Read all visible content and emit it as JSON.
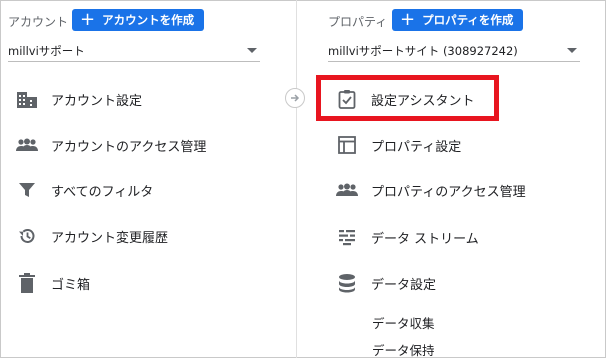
{
  "account": {
    "header_label": "アカウント",
    "create_button": "アカウントを作成",
    "selected": "millviサポート",
    "items": [
      {
        "label": "アカウント設定",
        "icon": "building-icon"
      },
      {
        "label": "アカウントのアクセス管理",
        "icon": "people-icon"
      },
      {
        "label": "すべてのフィルタ",
        "icon": "filter-icon"
      },
      {
        "label": "アカウント変更履歴",
        "icon": "history-icon"
      },
      {
        "label": "ゴミ箱",
        "icon": "trash-icon"
      }
    ]
  },
  "property": {
    "header_label": "プロパティ",
    "create_button": "プロパティを作成",
    "selected": "millviサポートサイト (308927242)",
    "items": [
      {
        "label": "設定アシスタント",
        "icon": "clipboard-check-icon",
        "highlighted": true
      },
      {
        "label": "プロパティ設定",
        "icon": "layout-icon"
      },
      {
        "label": "プロパティのアクセス管理",
        "icon": "people-icon"
      },
      {
        "label": "データ ストリーム",
        "icon": "streams-icon"
      },
      {
        "label": "データ設定",
        "icon": "database-icon"
      }
    ],
    "sub_items": [
      "データ収集",
      "データ保持"
    ]
  },
  "colors": {
    "accent": "#1a73e8",
    "highlight": "#e8151f",
    "icon": "#5f6368"
  }
}
